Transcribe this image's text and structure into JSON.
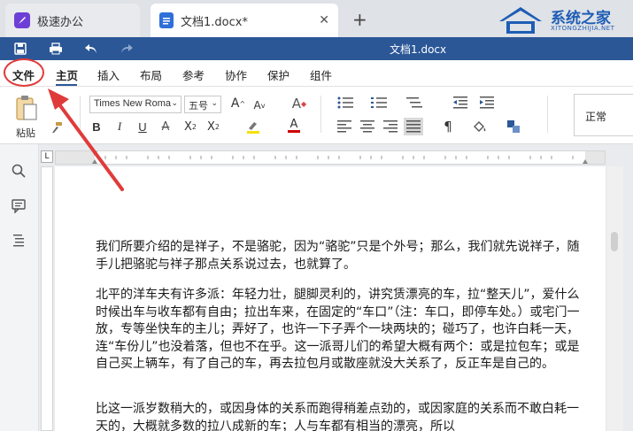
{
  "tabs": {
    "app_label": "极速办公",
    "doc_label": "文档1.docx*",
    "close_symbol": "✕",
    "new_symbol": "+"
  },
  "brand": {
    "name": "系统之家",
    "sub": "XITONGZHIJIA.NET"
  },
  "titlebar": {
    "title": "文档1.docx"
  },
  "menu": {
    "file": "文件",
    "home": "主页",
    "insert": "插入",
    "layout": "布局",
    "reference": "参考",
    "collab": "协作",
    "protect": "保护",
    "component": "组件"
  },
  "ribbon": {
    "paste_label": "粘贴",
    "font_name": "Times New Roma",
    "font_size": "五号",
    "style_normal": "正常",
    "bold": "B",
    "italic": "I",
    "underline": "U"
  },
  "ruler": {
    "corner": "L"
  },
  "document": {
    "paragraphs": [
      "我们所要介绍的是祥子，不是骆驼，因为“骆驼”只是个外号；那么，我们就先说祥子，随手儿把骆驼与祥子那点关系说过去，也就算了。",
      "北平的洋车夫有许多派：年轻力壮，腿脚灵利的，讲究赁漂亮的车，拉“整天儿”，爱什么时候出车与收车都有自由；拉出车来，在固定的“车口”（注：车口，即停车处。）或宅门一放，专等坐快车的主儿；弄好了，也许一下子弄个一块两块的；碰巧了，也许白耗一天，连“车份儿”也没着落，但也不在乎。这一派哥儿们的希望大概有两个：或是拉包车；或是自己买上辆车，有了自己的车，再去拉包月或散座就没大关系了，反正车是自己的。",
      "比这一派岁数稍大的，或因身体的关系而跑得稍差点劲的，或因家庭的关系而不敢白耗一天的，大概就多数的拉八成新的车；人与车都有相当的漂亮，所以"
    ]
  },
  "colors": {
    "titlebar": "#2b5797",
    "highlight_circle": "#e03b3b",
    "arrow": "#e03b3b"
  }
}
